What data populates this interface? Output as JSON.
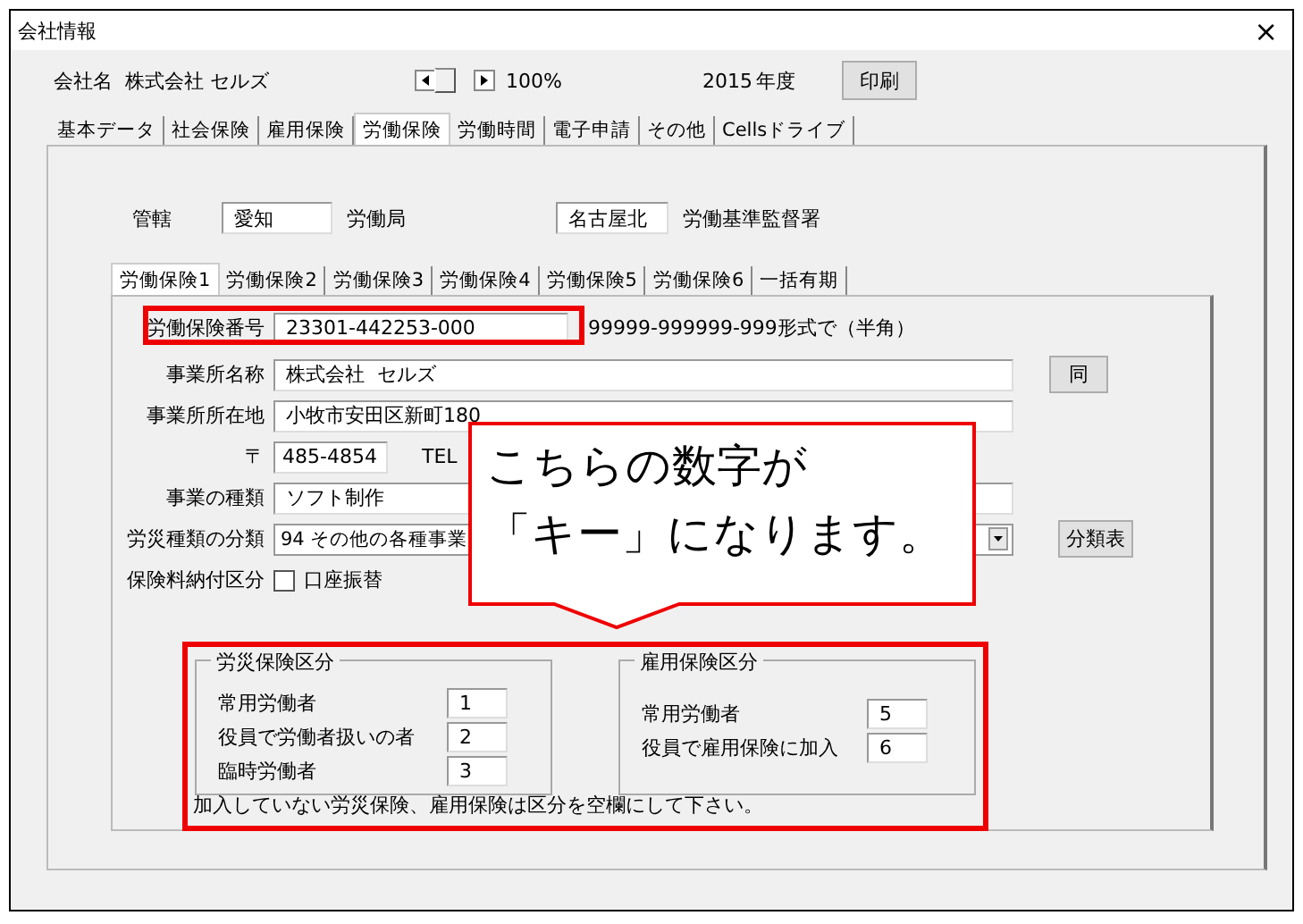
{
  "window": {
    "title": "会社情報",
    "close": "×"
  },
  "header": {
    "company_label": "会社名",
    "company_name": "株式会社 セルズ",
    "zoom": "100%",
    "year": "2015",
    "year_label": "年度",
    "print_button": "印刷"
  },
  "tabs": [
    {
      "label": "基本データ",
      "selected": false
    },
    {
      "label": "社会保険",
      "selected": false
    },
    {
      "label": "雇用保険",
      "selected": false
    },
    {
      "label": "労働保険",
      "selected": true
    },
    {
      "label": "労働時間",
      "selected": false
    },
    {
      "label": "電子申請",
      "selected": false
    },
    {
      "label": "その他",
      "selected": false
    },
    {
      "label": "Cellsドライブ",
      "selected": false
    }
  ],
  "jurisdiction": {
    "label": "管轄",
    "bureau": "愛知",
    "bureau_label": "労働局",
    "office": "名古屋北",
    "office_label": "労働基準監督署"
  },
  "sub_tabs": [
    {
      "label": "労働保険1",
      "selected": true
    },
    {
      "label": "労働保険2",
      "selected": false
    },
    {
      "label": "労働保険3",
      "selected": false
    },
    {
      "label": "労働保険4",
      "selected": false
    },
    {
      "label": "労働保険5",
      "selected": false
    },
    {
      "label": "労働保険6",
      "selected": false
    },
    {
      "label": "一括有期",
      "selected": false
    }
  ],
  "insurance_number": {
    "label": "労働保険番号",
    "value": "23301-442253-000",
    "hint": "99999-999999-999形式で（半角）"
  },
  "office_name": {
    "label": "事業所名称",
    "value": "株式会社  セルズ",
    "button": "同"
  },
  "office_address": {
    "label": "事業所所在地",
    "value": "小牧市安田区新町180"
  },
  "postal": {
    "label": "〒",
    "value": "485-4854",
    "tel_label": "TEL"
  },
  "business_type": {
    "label": "事業の種類",
    "value": "ソフト制作"
  },
  "category": {
    "label": "労災種類の分類",
    "value": "94 その他の各種事業",
    "button": "分類表"
  },
  "payment": {
    "label": "保険料納付区分",
    "option": "口座振替",
    "checked": false
  },
  "workers_comp": {
    "title": "労災保険区分",
    "rows": [
      {
        "label": "常用労働者",
        "value": "1"
      },
      {
        "label": "役員で労働者扱いの者",
        "value": "2"
      },
      {
        "label": "臨時労働者",
        "value": "3"
      }
    ]
  },
  "employment": {
    "title": "雇用保険区分",
    "rows": [
      {
        "label": "常用労働者",
        "value": "5"
      },
      {
        "label": "役員で雇用保険に加入",
        "value": "6"
      }
    ]
  },
  "note": "加入していない労災保険、雇用保険は区分を空欄にして下さい。",
  "callout": {
    "lines": [
      "こちらの数字が",
      "「キー」になります。"
    ]
  }
}
